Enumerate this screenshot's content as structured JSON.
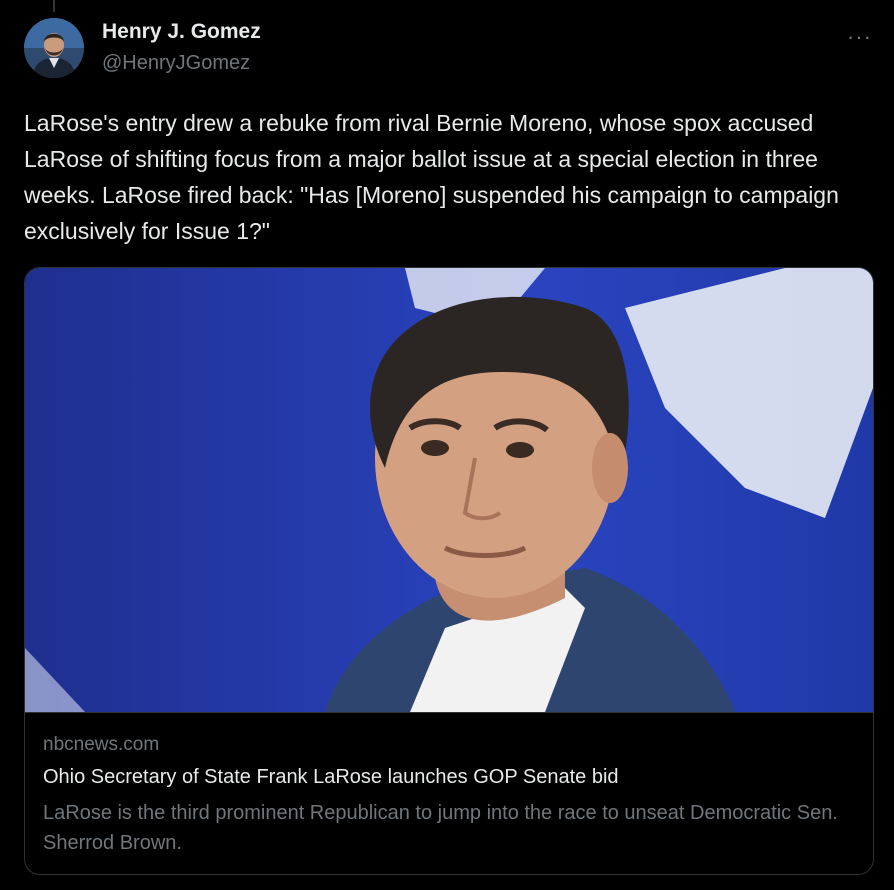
{
  "author": {
    "name": "Henry J. Gomez",
    "handle": "@HenryJGomez"
  },
  "menu": {
    "more_icon": "more-dots-icon",
    "more_label": "···"
  },
  "tweet": {
    "text": "LaRose's entry drew a rebuke from rival Bernie Moreno, whose spox accused LaRose of shifting focus from a major ballot issue at a special election in three weeks. LaRose fired back: \"Has [Moreno] suspended his campaign to campaign exclusively for Issue 1?\""
  },
  "card": {
    "domain": "nbcnews.com",
    "title": "Ohio Secretary of State Frank LaRose launches GOP Senate bid",
    "description": "LaRose is the third prominent Republican to jump into the race to unseat Democratic Sen. Sherrod Brown."
  },
  "colors": {
    "background": "#000000",
    "text_primary": "#e7e9ea",
    "text_secondary": "#71767b",
    "border": "#2f3336"
  }
}
